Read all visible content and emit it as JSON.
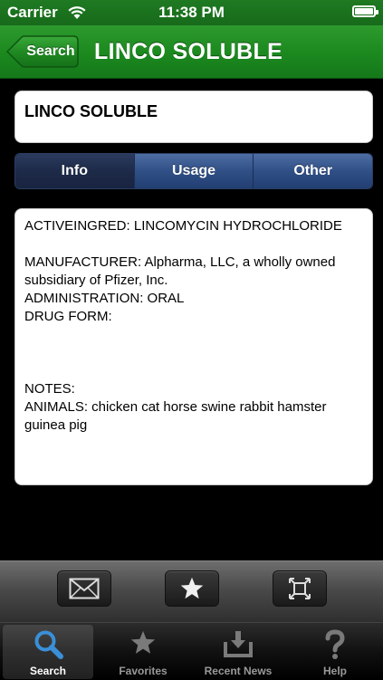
{
  "status_bar": {
    "carrier": "Carrier",
    "time": "11:38 PM"
  },
  "nav": {
    "back_label": "Search",
    "title": "LINCO SOLUBLE"
  },
  "title_card": {
    "text": "LINCO SOLUBLE"
  },
  "segments": [
    {
      "label": "Info",
      "selected": true
    },
    {
      "label": "Usage",
      "selected": false
    },
    {
      "label": "Other",
      "selected": false
    }
  ],
  "info": {
    "active_ingredient": "ACTIVEINGRED:   LINCOMYCIN HYDROCHLORIDE",
    "manufacturer": "MANUFACTURER:  Alpharma, LLC, a wholly owned subsidiary of Pfizer, Inc.",
    "administration": "ADMINISTRATION:   ORAL",
    "drug_form": "DRUG FORM:",
    "notes": "NOTES:",
    "animals": "ANIMALS: chicken cat horse swine  rabbit hamster guinea pig"
  },
  "toolbar": {
    "email_icon": "envelope-icon",
    "favorite_icon": "star-icon",
    "fullscreen_icon": "fullscreen-icon"
  },
  "tabs": [
    {
      "label": "Search",
      "icon": "magnifier-icon",
      "selected": true
    },
    {
      "label": "Favorites",
      "icon": "star-icon",
      "selected": false
    },
    {
      "label": "Recent News",
      "icon": "download-tray-icon",
      "selected": false
    },
    {
      "label": "Help",
      "icon": "question-icon",
      "selected": false
    }
  ],
  "colors": {
    "nav_green": "#1c8a1f",
    "segment_blue": "#2f4f86",
    "tab_active": "#3a8fd8"
  }
}
